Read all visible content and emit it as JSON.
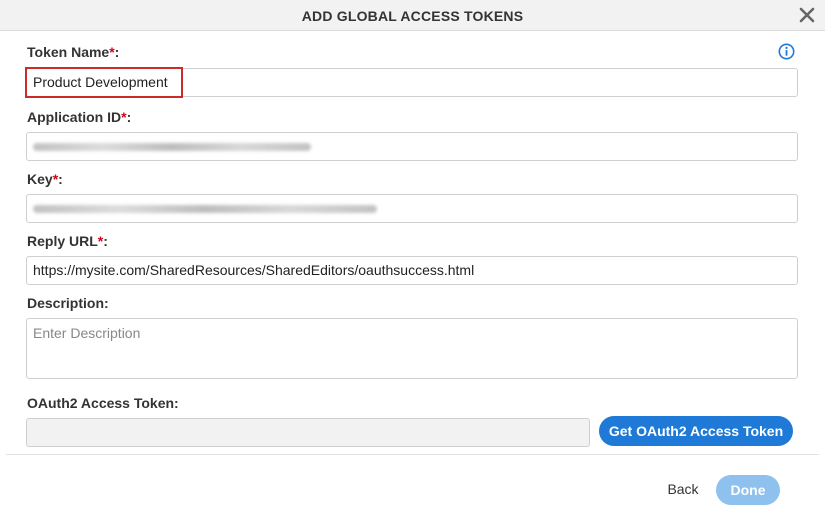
{
  "dialog": {
    "title": "ADD GLOBAL ACCESS TOKENS",
    "close_icon": "close-icon",
    "info_icon": "info-icon"
  },
  "fields": {
    "token_name": {
      "label": "Token Name",
      "required_mark": "*",
      "suffix": ":",
      "value": "Product Development"
    },
    "application_id": {
      "label": "Application ID",
      "required_mark": "*",
      "suffix": ":"
    },
    "key": {
      "label": "Key",
      "required_mark": "*",
      "suffix": ":"
    },
    "reply_url": {
      "label": "Reply URL",
      "required_mark": "*",
      "suffix": ":",
      "value": "https://mysite.com/SharedResources/SharedEditors/oauthsuccess.html"
    },
    "description": {
      "label": "Description:",
      "placeholder": "Enter Description"
    },
    "oauth2_token": {
      "label": "OAuth2 Access Token:"
    }
  },
  "buttons": {
    "get_oauth2": "Get OAuth2 Access Token",
    "back": "Back",
    "done": "Done"
  },
  "colors": {
    "primary": "#1e7ad6",
    "done_disabled": "#8ec1ed",
    "required": "#d0021b",
    "highlight": "#cc2b2b"
  }
}
